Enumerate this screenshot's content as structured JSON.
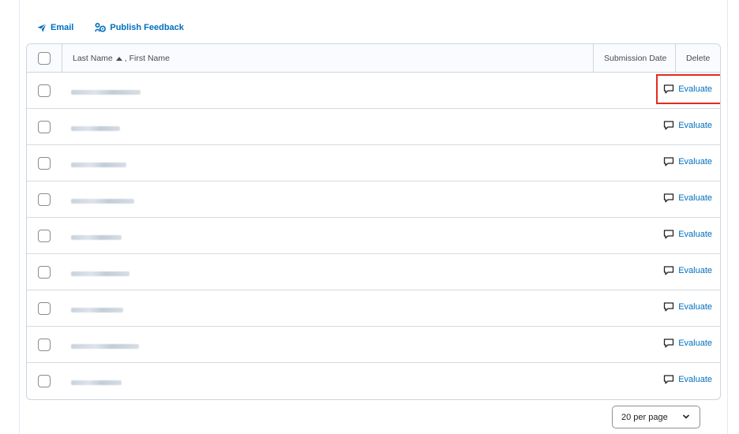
{
  "toolbar": {
    "email_label": "Email",
    "publish_label": "Publish Feedback"
  },
  "table": {
    "headers": {
      "name": "Last Name",
      "name_suffix": ", First Name",
      "submission_date": "Submission Date",
      "delete": "Delete"
    },
    "rows": [
      {
        "evaluate_label": "Evaluate",
        "highlighted": true
      },
      {
        "evaluate_label": "Evaluate"
      },
      {
        "evaluate_label": "Evaluate"
      },
      {
        "evaluate_label": "Evaluate"
      },
      {
        "evaluate_label": "Evaluate"
      },
      {
        "evaluate_label": "Evaluate"
      },
      {
        "evaluate_label": "Evaluate"
      },
      {
        "evaluate_label": "Evaluate"
      },
      {
        "evaluate_label": "Evaluate"
      }
    ]
  },
  "pagination": {
    "per_page_label": "20 per page"
  },
  "colors": {
    "link": "#006fbf",
    "highlight": "#e32b1e",
    "border": "#cdd5dc"
  },
  "icons": {
    "email": "paper-plane-icon",
    "publish": "people-feedback-icon",
    "evaluate": "speech-bubble-icon",
    "sort": "sort-ascending-icon",
    "dropdown": "chevron-down-icon"
  }
}
